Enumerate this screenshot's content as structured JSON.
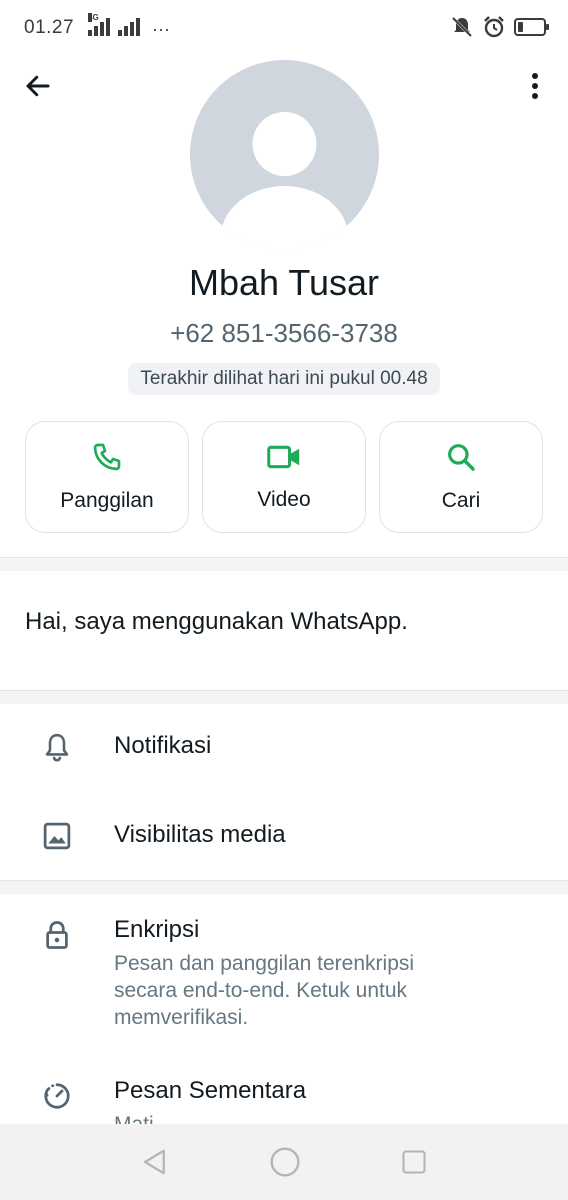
{
  "status_bar": {
    "time": "01.27",
    "network": "4G",
    "more": "···",
    "icons": [
      "signal-icon",
      "signal-icon",
      "mute-icon",
      "alarm-icon",
      "battery-icon"
    ],
    "battery_level": 0.2
  },
  "header": {
    "back_icon": "arrow-left-icon",
    "menu_icon": "more-vertical-icon"
  },
  "profile": {
    "avatar_icon": "default-avatar-icon",
    "name": "Mbah Tusar",
    "phone": "+62 851-3566-3738",
    "last_seen": "Terakhir dilihat hari ini pukul 00.48"
  },
  "actions": [
    {
      "label": "Panggilan",
      "icon": "phone-icon"
    },
    {
      "label": "Video",
      "icon": "video-icon"
    },
    {
      "label": "Cari",
      "icon": "search-icon"
    }
  ],
  "about": "Hai, saya menggunakan WhatsApp.",
  "settings": [
    {
      "label": "Notifikasi",
      "icon": "bell-icon"
    },
    {
      "label": "Visibilitas media",
      "icon": "image-icon"
    }
  ],
  "privacy": [
    {
      "label": "Enkripsi",
      "icon": "lock-icon",
      "subtitle": "Pesan dan panggilan terenkripsi secara end-to-end. Ketuk untuk memverifikasi."
    },
    {
      "label": "Pesan Sementara",
      "icon": "timer-icon",
      "subtitle": "Mati"
    }
  ],
  "colors": {
    "accent": "#1faa59",
    "text_primary": "#111b21",
    "text_secondary": "#667781",
    "avatar_bg": "#cfd6dd"
  },
  "navbar": [
    "back-triangle-icon",
    "home-circle-icon",
    "recents-square-icon"
  ]
}
